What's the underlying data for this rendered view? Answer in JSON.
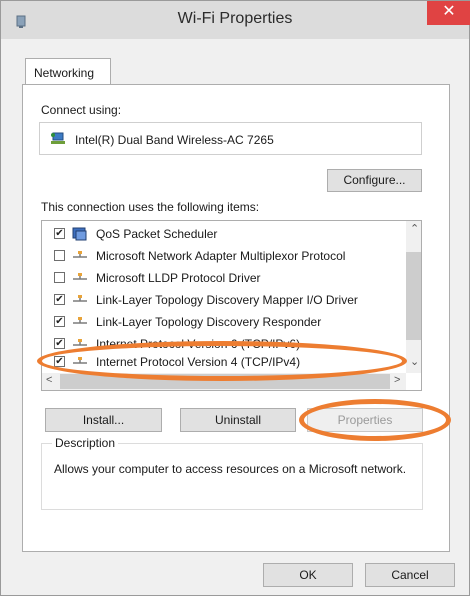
{
  "window": {
    "title": "Wi-Fi Properties",
    "close_glyph": "✕"
  },
  "tab": {
    "label": "Networking"
  },
  "connect": {
    "label": "Connect using:",
    "adapter": "Intel(R) Dual Band Wireless-AC 7265",
    "adapter_icon": "network-adapter-icon"
  },
  "configure_label": "Configure...",
  "items_label": "This connection uses the following items:",
  "items": [
    {
      "label": "QoS Packet Scheduler",
      "checked": "✔",
      "icon": "qos-scheduler-icon"
    },
    {
      "label": "Microsoft Network Adapter Multiplexor Protocol",
      "checked": "",
      "icon": "protocol-icon"
    },
    {
      "label": "Microsoft LLDP Protocol Driver",
      "checked": "",
      "icon": "protocol-icon"
    },
    {
      "label": "Link-Layer Topology Discovery Mapper I/O Driver",
      "checked": "✔",
      "icon": "protocol-icon"
    },
    {
      "label": "Link-Layer Topology Discovery Responder",
      "checked": "✔",
      "icon": "protocol-icon"
    },
    {
      "label": "Internet Protocol Version 6 (TCP/IPv6)",
      "checked": "✔",
      "icon": "protocol-icon"
    },
    {
      "label": "Internet Protocol Version 4 (TCP/IPv4)",
      "checked": "✔",
      "icon": "protocol-icon"
    }
  ],
  "scroll": {
    "up": "⌃",
    "down": "⌄",
    "left": "<",
    "right": ">"
  },
  "buttons": {
    "install": "Install...",
    "uninstall": "Uninstall",
    "properties": "Properties"
  },
  "description": {
    "legend": "Description",
    "text": "Allows your computer to access resources on a Microsoft network."
  },
  "footer": {
    "ok": "OK",
    "cancel": "Cancel"
  },
  "colors": {
    "highlight_oval": "#ed7d31",
    "close_button": "#e04343"
  }
}
